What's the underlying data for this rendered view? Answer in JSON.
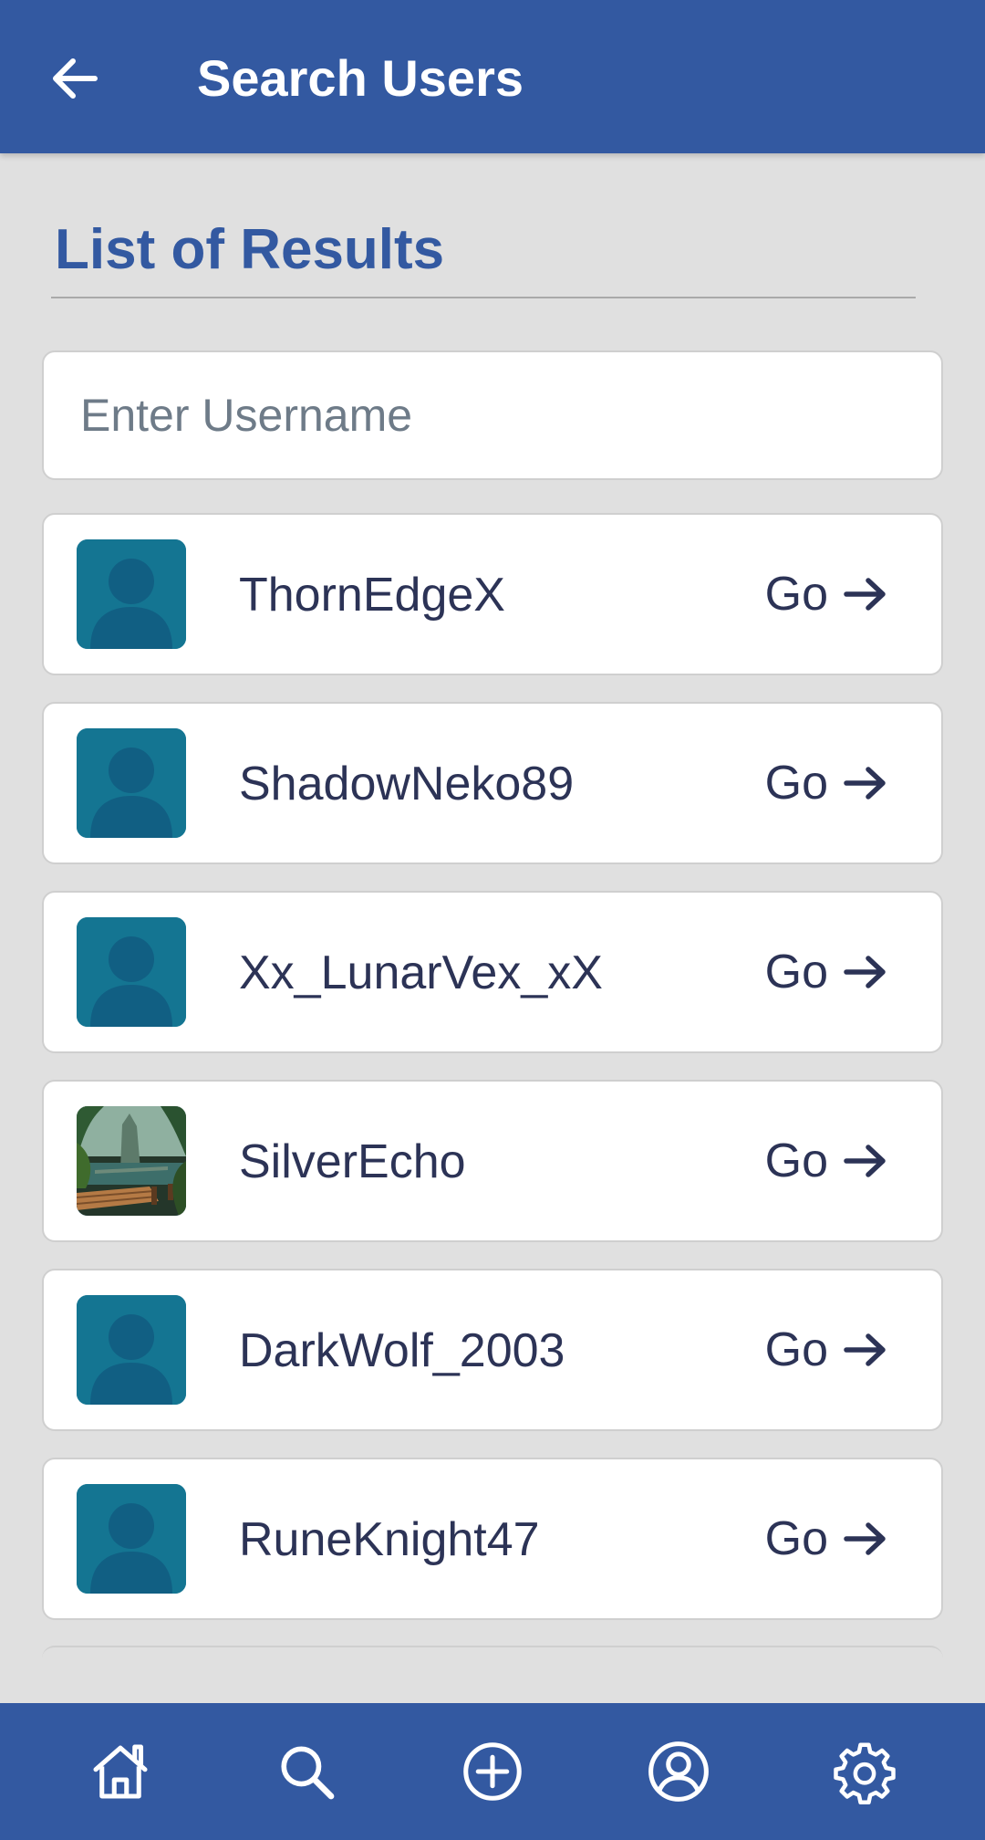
{
  "header": {
    "title": "Search Users",
    "back_icon": "arrow-left-icon"
  },
  "section": {
    "title": "List of Results"
  },
  "search": {
    "value": "",
    "placeholder": "Enter Username"
  },
  "results": [
    {
      "username": "ThornEdgeX",
      "avatar": "default-user-icon",
      "action_label": "Go"
    },
    {
      "username": "ShadowNeko89",
      "avatar": "default-user-icon",
      "action_label": "Go"
    },
    {
      "username": "Xx_LunarVex_xX",
      "avatar": "default-user-icon",
      "action_label": "Go"
    },
    {
      "username": "SilverEcho",
      "avatar": "jungle-landscape-image",
      "action_label": "Go"
    },
    {
      "username": "DarkWolf_2003",
      "avatar": "default-user-icon",
      "action_label": "Go"
    },
    {
      "username": "RuneKnight47",
      "avatar": "default-user-icon",
      "action_label": "Go"
    }
  ],
  "bottom_nav": [
    {
      "name": "home",
      "icon": "home-icon"
    },
    {
      "name": "search",
      "icon": "search-icon"
    },
    {
      "name": "create",
      "icon": "plus-circle-icon"
    },
    {
      "name": "profile",
      "icon": "user-circle-icon"
    },
    {
      "name": "settings",
      "icon": "gear-icon"
    }
  ],
  "colors": {
    "primary": "#3359a1",
    "background": "#e0e0e0",
    "card": "#ffffff",
    "text": "#2c3356",
    "avatar_bg": "#147592",
    "avatar_silhouette": "#115f83"
  }
}
